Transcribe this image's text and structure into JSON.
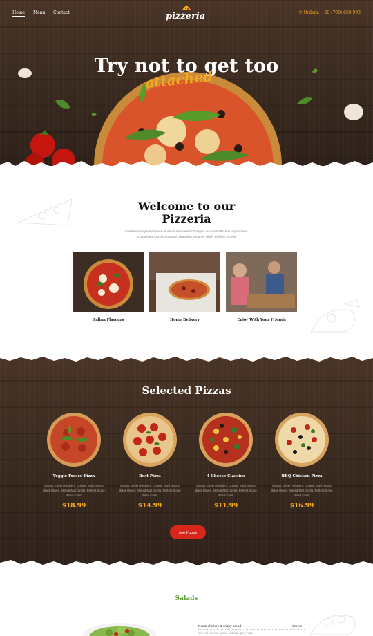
{
  "nav": {
    "items": [
      {
        "label": "Home"
      },
      {
        "label": "Menu"
      },
      {
        "label": "Contact"
      }
    ],
    "logo": "pizzeria",
    "orders": "Orders: +20 (700) 650 993"
  },
  "hero": {
    "title": "Try not to get too",
    "script": "attached"
  },
  "welcome": {
    "title_line1": "Welcome to our",
    "title_line2": "Pizzeria",
    "text_line1": "Collaboratively benchmark multifunctional methodologies vis-a-vis effective imperatives.",
    "text_line2": "Completely morph proactive bandwidth vis-a-vis highly efficient niches",
    "features": [
      {
        "caption": "Italian Flavours"
      },
      {
        "caption": "Home Delivery"
      },
      {
        "caption": "Enjoy With Your Friends"
      }
    ]
  },
  "selected": {
    "title": "Selected Pizzas",
    "pizzas": [
      {
        "name": "Veggie Fresco Pizza",
        "desc1": "Tomato, Green Peppers, Onions, Mushrooms,",
        "desc2": "Black Olives, Melted Mozzarella, Perfect Stone",
        "desc3": "Fired Crust",
        "price": "$18.99"
      },
      {
        "name": "Best Pizza",
        "desc1": "Tomato, Green Peppers, Onions, Mushrooms,",
        "desc2": "Black Olives, Melted Mozzarella, Perfect Stone",
        "desc3": "Fired Crust",
        "price": "$14.99"
      },
      {
        "name": "4 Cheese Classico",
        "desc1": "Tomato, Green Peppers, Onions, Mushrooms,",
        "desc2": "Black Olives, Melted Mozzarella, Perfect Stone",
        "desc3": "Fired Crust",
        "price": "$11.99"
      },
      {
        "name": "BBQ Chicken Pizza",
        "desc1": "Tomato, Green Peppers, Onions, Mushrooms,",
        "desc2": "Black Olives, Melted Mozzarella, Perfect Stone",
        "desc3": "Fired Crust",
        "price": "$16.99"
      }
    ],
    "button": "See Pizzas"
  },
  "salads": {
    "title": "Salads",
    "item_name": "Roast chicken & crispy bread",
    "item_price": "$11.99",
    "item_desc": "olive oil, lemon, garlic, ciabatta, pine nuts"
  },
  "colors": {
    "accent": "#f4a81d",
    "button": "#d9261c",
    "salads": "#5a9c2a",
    "wood": "#3a2a1f"
  }
}
